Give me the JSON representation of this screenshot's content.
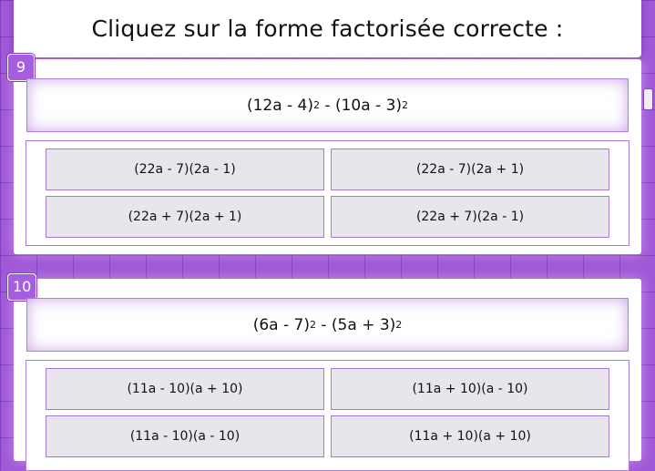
{
  "header": {
    "title": "Cliquez sur la forme factorisée correcte :"
  },
  "questions": [
    {
      "number": "9",
      "expression": {
        "a": "(12a - 4)",
        "exp_a": "2",
        "sep": " - ",
        "b": "(10a - 3)",
        "exp_b": "2"
      },
      "choices": [
        "(22a - 7)(2a - 1)",
        "(22a - 7)(2a + 1)",
        "(22a + 7)(2a + 1)",
        "(22a + 7)(2a - 1)"
      ]
    },
    {
      "number": "10",
      "expression": {
        "a": "(6a - 7)",
        "exp_a": "2",
        "sep": " - ",
        "b": "(5a + 3)",
        "exp_b": "2"
      },
      "choices": [
        "(11a - 10)(a + 10)",
        "(11a + 10)(a - 10)",
        "(11a - 10)(a - 10)",
        "(11a + 10)(a + 10)"
      ]
    }
  ]
}
